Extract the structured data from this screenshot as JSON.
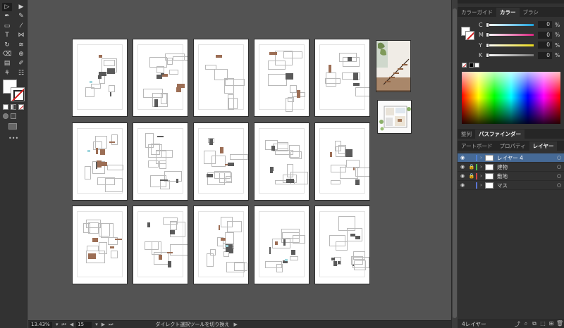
{
  "tools": [
    [
      "direct-selection-tool",
      "selection-tool"
    ],
    [
      "pen-tool",
      "curvature-tool"
    ],
    [
      "rectangle-tool",
      "paintbrush-tool"
    ],
    [
      "type-tool",
      "reflect-tool"
    ],
    [
      "rotate-tool",
      "width-tool"
    ],
    [
      "eraser-tool",
      "shape-builder-tool"
    ],
    [
      "gradient-tool",
      "eyedropper-tool"
    ],
    [
      "blend-tool",
      "symbol-sprayer-tool"
    ],
    [
      "artboard-tool",
      "zoom-tool"
    ]
  ],
  "tool_glyphs": [
    [
      "▷",
      "▶"
    ],
    [
      "✒",
      "✎"
    ],
    [
      "▭",
      "⁄"
    ],
    [
      "T",
      "⋈"
    ],
    [
      "↻",
      "≋"
    ],
    [
      "⌫",
      "⊕"
    ],
    [
      "▤",
      "✐"
    ],
    [
      "⚘",
      "☷"
    ],
    [
      "⧉",
      "⌕"
    ]
  ],
  "toolbar_more": "•••",
  "color_panel": {
    "tabs": [
      "カラーガイド",
      "カラー",
      "ブラシ"
    ],
    "active_tab": 1,
    "channels": [
      {
        "label": "C",
        "value": "0",
        "unit": "%",
        "color": "#1ca0d9"
      },
      {
        "label": "M",
        "value": "0",
        "unit": "%",
        "color": "#d6247e"
      },
      {
        "label": "Y",
        "value": "0",
        "unit": "%",
        "color": "#e8d81a"
      },
      {
        "label": "K",
        "value": "0",
        "unit": "%",
        "color": "#777777"
      }
    ]
  },
  "align_panel": {
    "tabs": [
      "整列",
      "パスファインダー"
    ],
    "active_tab": 1
  },
  "layers_panel": {
    "tabs": [
      "アートボード",
      "プロパティ",
      "レイヤー"
    ],
    "active_tab": 2,
    "layers": [
      {
        "name": "レイヤー 4",
        "color": "#4e7fd4",
        "locked": false,
        "active": true
      },
      {
        "name": "建物",
        "color": "#4fc24f",
        "locked": true,
        "active": false
      },
      {
        "name": "敷地",
        "color": "#d24343",
        "locked": true,
        "active": false
      },
      {
        "name": "マス",
        "color": "#5a74d4",
        "locked": false,
        "active": false
      }
    ],
    "count_label": "4レイヤー"
  },
  "status": {
    "zoom": "13.43%",
    "page": "15",
    "text": "ダイレクト選択ツールを切り換え"
  },
  "glyphs": {
    "eye": "◉",
    "lock": "🔒",
    "chevron": "›",
    "target": "○",
    "first": "⏮",
    "prev": "◀",
    "next": "▶",
    "last": "⏭",
    "dropdown": "▾",
    "footer_icons": [
      "⤴",
      "⌕",
      "⧉",
      "⬚",
      "⊞",
      "🗑"
    ]
  }
}
